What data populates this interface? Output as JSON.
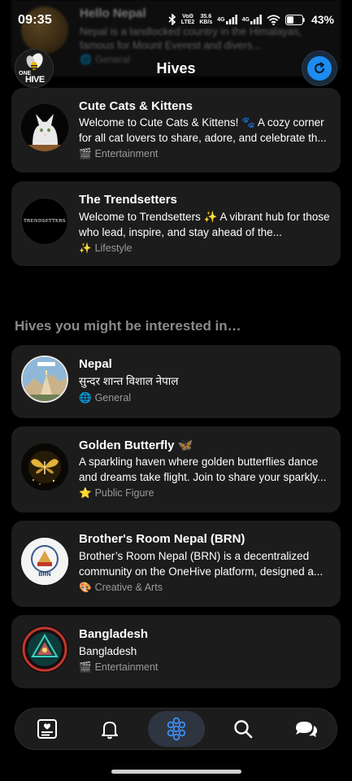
{
  "status_bar": {
    "time": "09:35",
    "network_labels": [
      "Voʘ",
      "LTE2",
      "35.6",
      "KB/s",
      "4G",
      "4G"
    ],
    "battery_percent": "43%"
  },
  "behind_card": {
    "title": "Hello Nepal",
    "description": "Nepal is a landlocked country in the Himalayas, famous for Mount Everest and divers...",
    "category_icon": "globe-icon",
    "category": "General"
  },
  "header": {
    "title": "Hives",
    "logo_text_top": "ONE",
    "logo_text_bottom": "HIVE"
  },
  "my_hives": [
    {
      "title": "Cute Cats & Kittens",
      "description": "Welcome to Cute Cats & Kittens! 🐾 A cozy corner for all cat lovers to share, adore, and celebrate th...",
      "category_emoji": "🎬",
      "category": "Entertainment"
    },
    {
      "title": "The Trendsetters",
      "avatar_text": "TRENDSETTERS",
      "description": "Welcome to Trendsetters ✨ A vibrant hub for those who lead, inspire, and stay ahead of the...",
      "category_emoji": "✨",
      "category": "Lifestyle"
    }
  ],
  "suggested_section_title": "Hives you might be interested in…",
  "suggested_hives": [
    {
      "title": "Nepal",
      "description": "सुन्दर शान्त विशाल नेपाल",
      "category_emoji": "🌐",
      "category": "General"
    },
    {
      "title": "Golden Butterfly 🦋",
      "description": "A sparkling haven where golden butterflies dance and dreams take flight. Join to share your sparkly...",
      "category_emoji": "⭐",
      "category": "Public Figure"
    },
    {
      "title": "Brother's Room Nepal (BRN)",
      "avatar_text": "BRN",
      "description": "Brother’s Room Nepal (BRN) is a decentralized community on the OneHive platform, designed a...",
      "category_emoji": "🎨",
      "category": "Creative & Arts"
    },
    {
      "title": "Bangladesh",
      "description": "Bangladesh",
      "category_emoji": "🎬",
      "category": "Entertainment"
    }
  ],
  "bottom_nav": [
    {
      "name": "feed",
      "icon": "feed-icon"
    },
    {
      "name": "notifications",
      "icon": "bell-icon"
    },
    {
      "name": "hives",
      "icon": "hive-icon",
      "active": true
    },
    {
      "name": "search",
      "icon": "search-icon"
    },
    {
      "name": "messages",
      "icon": "chat-icon"
    }
  ],
  "colors": {
    "background": "#000000",
    "card": "#1c1c1c",
    "accent": "#1d8bf1",
    "muted_text": "#9a9a9a"
  }
}
